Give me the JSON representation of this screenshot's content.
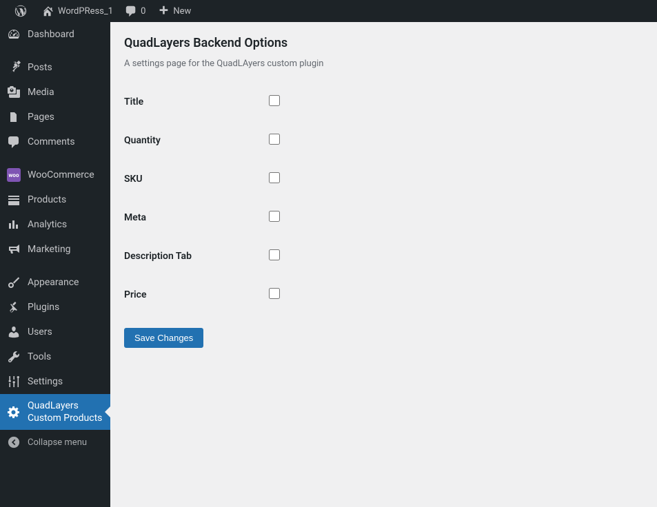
{
  "admin_bar": {
    "site_name": "WordPRess_1",
    "comments_count": "0",
    "new_label": "New"
  },
  "sidebar": {
    "items": [
      {
        "label": "Dashboard"
      },
      {
        "label": "Posts"
      },
      {
        "label": "Media"
      },
      {
        "label": "Pages"
      },
      {
        "label": "Comments"
      },
      {
        "label": "WooCommerce"
      },
      {
        "label": "Products"
      },
      {
        "label": "Analytics"
      },
      {
        "label": "Marketing"
      },
      {
        "label": "Appearance"
      },
      {
        "label": "Plugins"
      },
      {
        "label": "Users"
      },
      {
        "label": "Tools"
      },
      {
        "label": "Settings"
      },
      {
        "label": "QuadLayers Custom Products"
      }
    ],
    "collapse_label": "Collapse menu"
  },
  "page": {
    "title": "QuadLayers Backend Options",
    "description": "A settings page for the QuadLAyers custom plugin",
    "fields": [
      {
        "label": "Title"
      },
      {
        "label": "Quantity"
      },
      {
        "label": "SKU"
      },
      {
        "label": "Meta"
      },
      {
        "label": "Description Tab"
      },
      {
        "label": "Price"
      }
    ],
    "submit_label": "Save Changes"
  }
}
